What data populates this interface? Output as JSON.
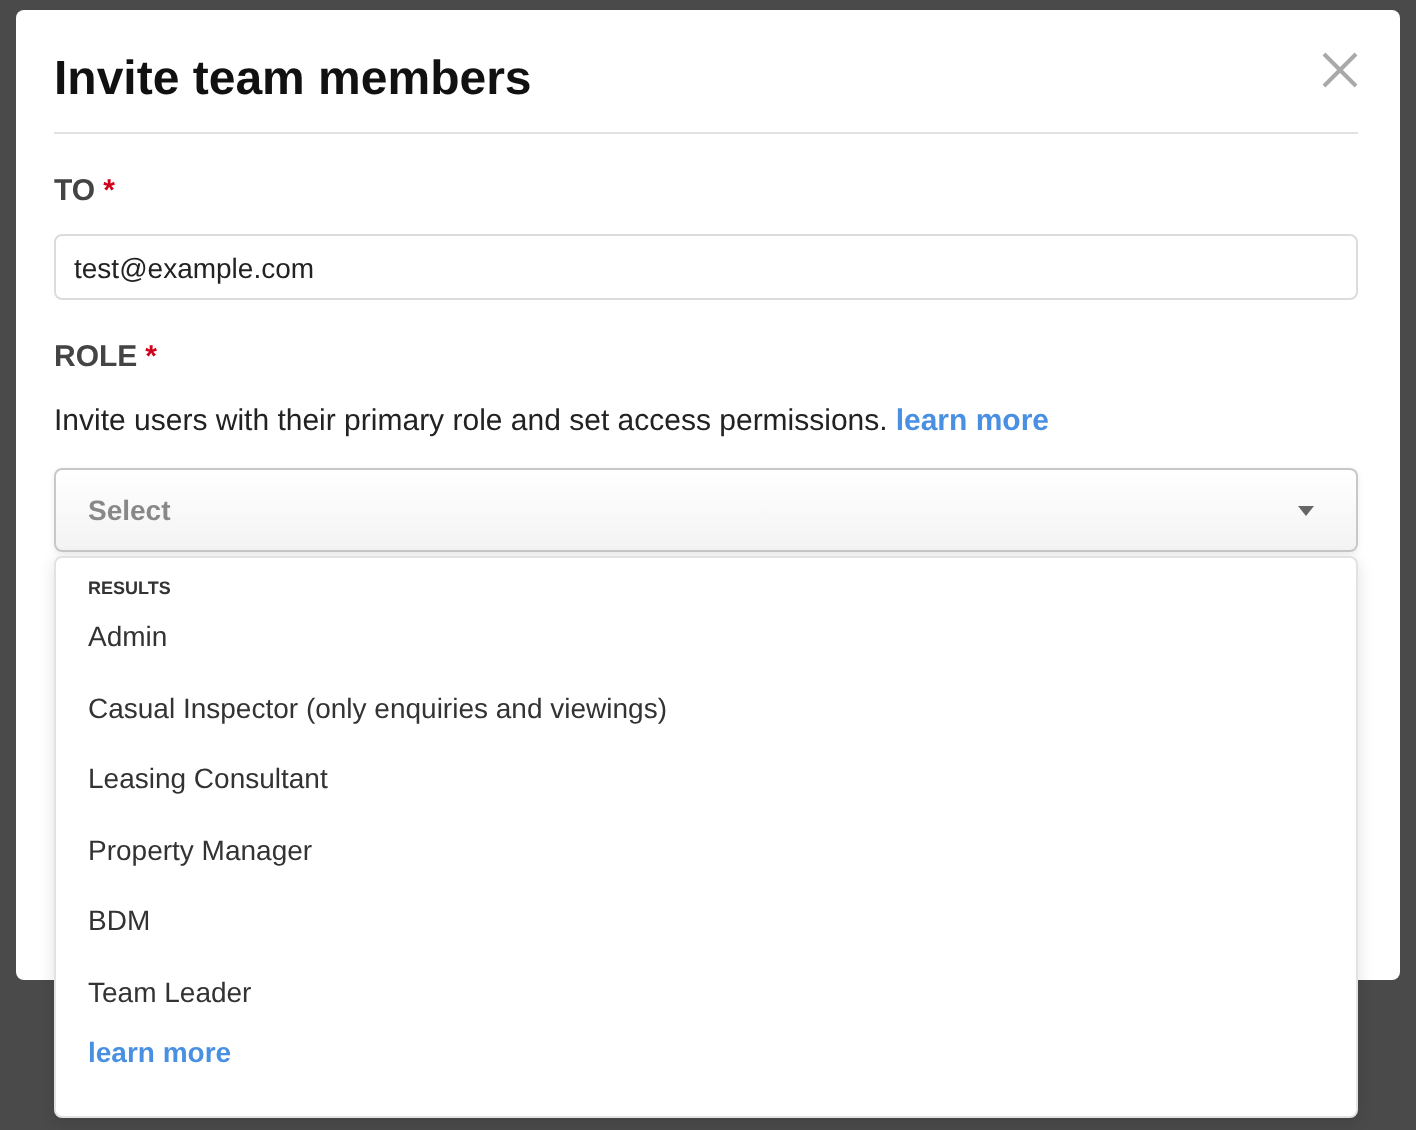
{
  "dialog": {
    "title": "Invite team members",
    "to": {
      "label": "TO",
      "required_mark": "*",
      "value": "test@example.com"
    },
    "role": {
      "label": "ROLE",
      "required_mark": "*",
      "description": "Invite users with their primary role and set access permissions.",
      "link": "learn more",
      "select": {
        "placeholder": "Select",
        "expanded": true
      },
      "dropdown": {
        "heading": "RESULTS",
        "options": [
          {
            "label": "Admin",
            "selected": false
          },
          {
            "label": "Casual Inspector (only enquiries and viewings)",
            "selected": false
          },
          {
            "label": "Leasing Consultant",
            "selected": false
          },
          {
            "label": "Property Manager",
            "selected": false
          },
          {
            "label": "BDM",
            "selected": false
          },
          {
            "label": "Team Leader",
            "selected": false
          }
        ],
        "link": "learn more"
      }
    }
  }
}
